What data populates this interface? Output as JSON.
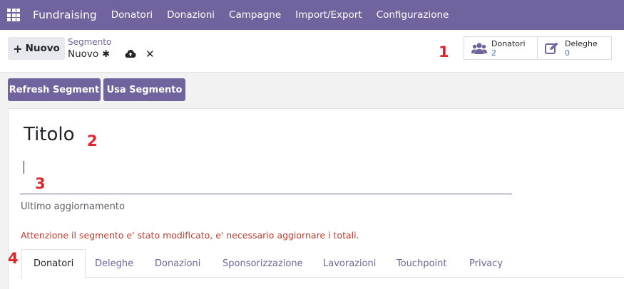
{
  "topbar": {
    "app_name": "Fundraising",
    "menu": [
      "Donatori",
      "Donazioni",
      "Campagne",
      "Import/Export",
      "Configurazione"
    ]
  },
  "control_panel": {
    "new_button": "Nuovo",
    "new_icon": "+",
    "breadcrumb_parent": "Segmento",
    "breadcrumb_current": "Nuovo",
    "stat_buttons": [
      {
        "label": "Donatori",
        "value": "2",
        "icon": "users-icon"
      },
      {
        "label": "Deleghe",
        "value": "0",
        "icon": "edit-icon"
      }
    ]
  },
  "annotations": [
    "1",
    "2",
    "3",
    "4"
  ],
  "actions": {
    "refresh": "Refresh Segment",
    "use": "Usa Segmento"
  },
  "form": {
    "title": "Titolo",
    "name_value": "",
    "last_update_label": "Ultimo aggiornamento",
    "warning": "Attenzione il segmento e' stato modificato, e' necessario aggiornare i totali.",
    "tabs": [
      "Donatori",
      "Deleghe",
      "Donazioni",
      "Sponsorizzazione",
      "Lavorazioni",
      "Touchpoint",
      "Privacy"
    ],
    "active_tab": "Donatori"
  },
  "colors": {
    "brand": "#71639e",
    "warning": "#c83a2c",
    "annotation": "#e0242b"
  }
}
